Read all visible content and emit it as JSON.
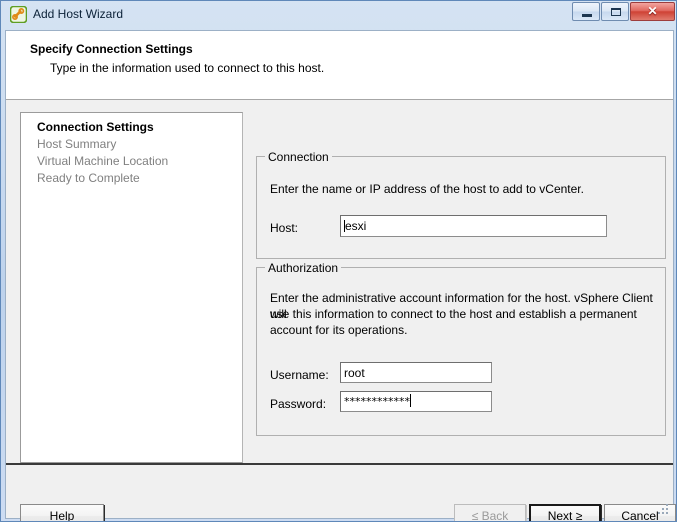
{
  "window": {
    "title": "Add Host Wizard",
    "icon": "wizard-icon",
    "controls": {
      "minimize": "minimize-icon",
      "maximize": "maximize-icon",
      "close": "✕"
    }
  },
  "header": {
    "title": "Specify Connection Settings",
    "subtitle": "Type in the information used to connect to this host."
  },
  "nav": {
    "items": [
      {
        "label": "Connection Settings",
        "active": true
      },
      {
        "label": "Host Summary",
        "active": false
      },
      {
        "label": "Virtual Machine Location",
        "active": false
      },
      {
        "label": "Ready to Complete",
        "active": false
      }
    ]
  },
  "connection": {
    "legend": "Connection",
    "description": "Enter the name or IP address of the host to add to vCenter.",
    "host_label": "Host:",
    "host_value": "esxi",
    "host_placeholder": ""
  },
  "authorization": {
    "legend": "Authorization",
    "description_line1": "Enter the administrative account information for the host. vSphere Client will",
    "description_line2": "use this information to connect to the host and establish a permanent",
    "description_line3": "account for its operations.",
    "username_label": "Username:",
    "username_value": "root",
    "password_label": "Password:",
    "password_value": "************"
  },
  "footer": {
    "help": "Help",
    "help_mnemonic": "H",
    "back": "Back",
    "back_prefix": "≤ ",
    "back_mnemonic": "B",
    "next": "Next",
    "next_suffix": " ≥",
    "next_mnemonic": "N",
    "cancel": "Cancel"
  },
  "colors": {
    "titlebar_blue": "#c3d6ee",
    "frame_border": "#5f88b9",
    "close_red": "#cf4235",
    "dialog_gray": "#f0f0f0",
    "panel_white": "#ffffff",
    "disabled_text": "#9a9a9a",
    "nav_inactive_text": "#808080"
  }
}
